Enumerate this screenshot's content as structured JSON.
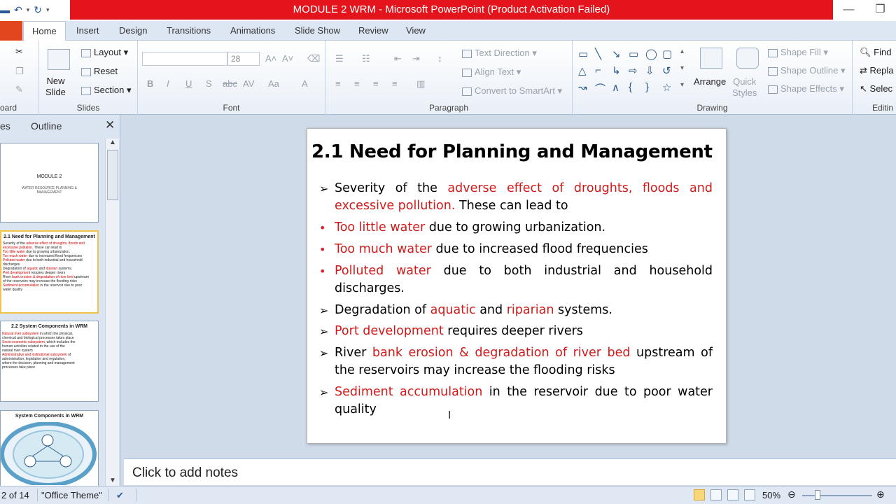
{
  "window": {
    "title": "MODULE 2 WRM  -  Microsoft PowerPoint (Product Activation Failed)",
    "controls": [
      "minimize-icon",
      "restore-icon"
    ]
  },
  "ribbon_tabs": [
    "Home",
    "Insert",
    "Design",
    "Transitions",
    "Animations",
    "Slide Show",
    "Review",
    "View"
  ],
  "ribbon": {
    "clipboard_label": "oard",
    "slides": {
      "new_slide": "New\nSlide",
      "layout": "Layout",
      "reset": "Reset",
      "section": "Section",
      "label": "Slides"
    },
    "font": {
      "size": "28",
      "label": "Font",
      "buttons": [
        "B",
        "I",
        "U",
        "S",
        "abc",
        "AV",
        "Aa",
        "A"
      ]
    },
    "paragraph": {
      "text_direction": "Text Direction",
      "align_text": "Align Text",
      "smartart": "Convert to SmartArt",
      "label": "Paragraph"
    },
    "drawing": {
      "arrange": "Arrange",
      "quick_styles": "Quick\nStyles",
      "shape_fill": "Shape Fill",
      "shape_outline": "Shape Outline",
      "shape_effects": "Shape Effects",
      "label": "Drawing"
    },
    "editing": {
      "find": "Find",
      "replace": "Repla",
      "select": "Selec",
      "label": "Editin"
    }
  },
  "left_pane": {
    "tab_slides": "es",
    "tab_outline": "Outline",
    "thumbnails": [
      {
        "title": "MODULE 2",
        "subtitle": "WATER RESOURCE PLANNING & MANAGEMENT"
      },
      {
        "title": "2.1 Need for Planning  and  Management"
      },
      {
        "title": "2.2 System Components in WRM"
      },
      {
        "title": "System Components  in WRM"
      }
    ]
  },
  "slide": {
    "title": "2.1 Need for Planning and  Management",
    "bullets": [
      {
        "marker": "arrow",
        "segments": [
          [
            "Severity of the ",
            "k"
          ],
          [
            "adverse effect of droughts, floods and excessive pollution.",
            "r"
          ],
          [
            " These can lead to",
            "k"
          ]
        ]
      },
      {
        "marker": "dot",
        "segments": [
          [
            "Too little water",
            "r"
          ],
          [
            " due to growing urbanization.",
            "k"
          ]
        ]
      },
      {
        "marker": "dot",
        "segments": [
          [
            "Too much water",
            "r"
          ],
          [
            " due to increased flood frequencies",
            "k"
          ]
        ]
      },
      {
        "marker": "dot",
        "segments": [
          [
            " Polluted water",
            "r"
          ],
          [
            " due to both industrial and household discharges.",
            "k"
          ]
        ]
      },
      {
        "marker": "arrow",
        "segments": [
          [
            " Degradation of ",
            "k"
          ],
          [
            "aquatic",
            "r"
          ],
          [
            " and ",
            "k"
          ],
          [
            "riparian",
            "r"
          ],
          [
            " systems.",
            "k"
          ]
        ]
      },
      {
        "marker": "arrow",
        "segments": [
          [
            " Port development",
            "r"
          ],
          [
            "  requires deeper rivers",
            "k"
          ]
        ]
      },
      {
        "marker": "arrow",
        "segments": [
          [
            " River ",
            "k"
          ],
          [
            "bank erosion & degradation of river bed",
            "r"
          ],
          [
            " upstream of the reservoirs may increase the flooding risks",
            "k"
          ]
        ]
      },
      {
        "marker": "arrow",
        "segments": [
          [
            " Sediment accumulation",
            "r"
          ],
          [
            " in the reservoir due to poor water quality",
            "k"
          ]
        ]
      }
    ]
  },
  "notes_placeholder": "Click to add notes",
  "status": {
    "slide_count": "2 of 14",
    "theme": "\"Office Theme\"",
    "zoom": "50%",
    "zoom_level": 50
  }
}
